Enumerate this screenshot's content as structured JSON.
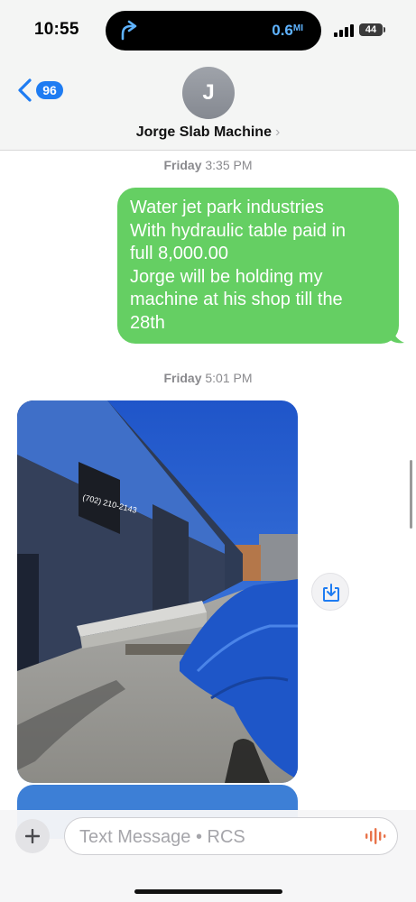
{
  "status_bar": {
    "time": "10:55",
    "nav_distance": "0.6",
    "nav_unit": "MI",
    "battery": "44",
    "icons": [
      "navigation-arrow-icon",
      "signal-bars-icon",
      "battery-icon"
    ]
  },
  "header": {
    "back_count": "96",
    "avatar_initial": "J",
    "contact_name": "Jorge Slab Machine",
    "chevron": "›"
  },
  "messages": [
    {
      "timestamp_day": "Friday",
      "timestamp_time": "3:35 PM",
      "direction": "outgoing",
      "lines": [
        "Water jet park industries",
        "With hydraulic table paid in",
        "full 8,000.00",
        "Jorge will be holding my",
        "machine at his shop till the",
        "28th"
      ]
    },
    {
      "timestamp_day": "Friday",
      "timestamp_time": "5:01 PM",
      "direction": "incoming",
      "type": "photo",
      "photo_sign_text": "(702) 210-2143"
    }
  ],
  "composer": {
    "placeholder": "Text Message • RCS",
    "value": ""
  },
  "colors": {
    "outgoing_bubble": "#65cf63",
    "badge": "#1e7cf2",
    "mic_accent": "#e8734a"
  }
}
